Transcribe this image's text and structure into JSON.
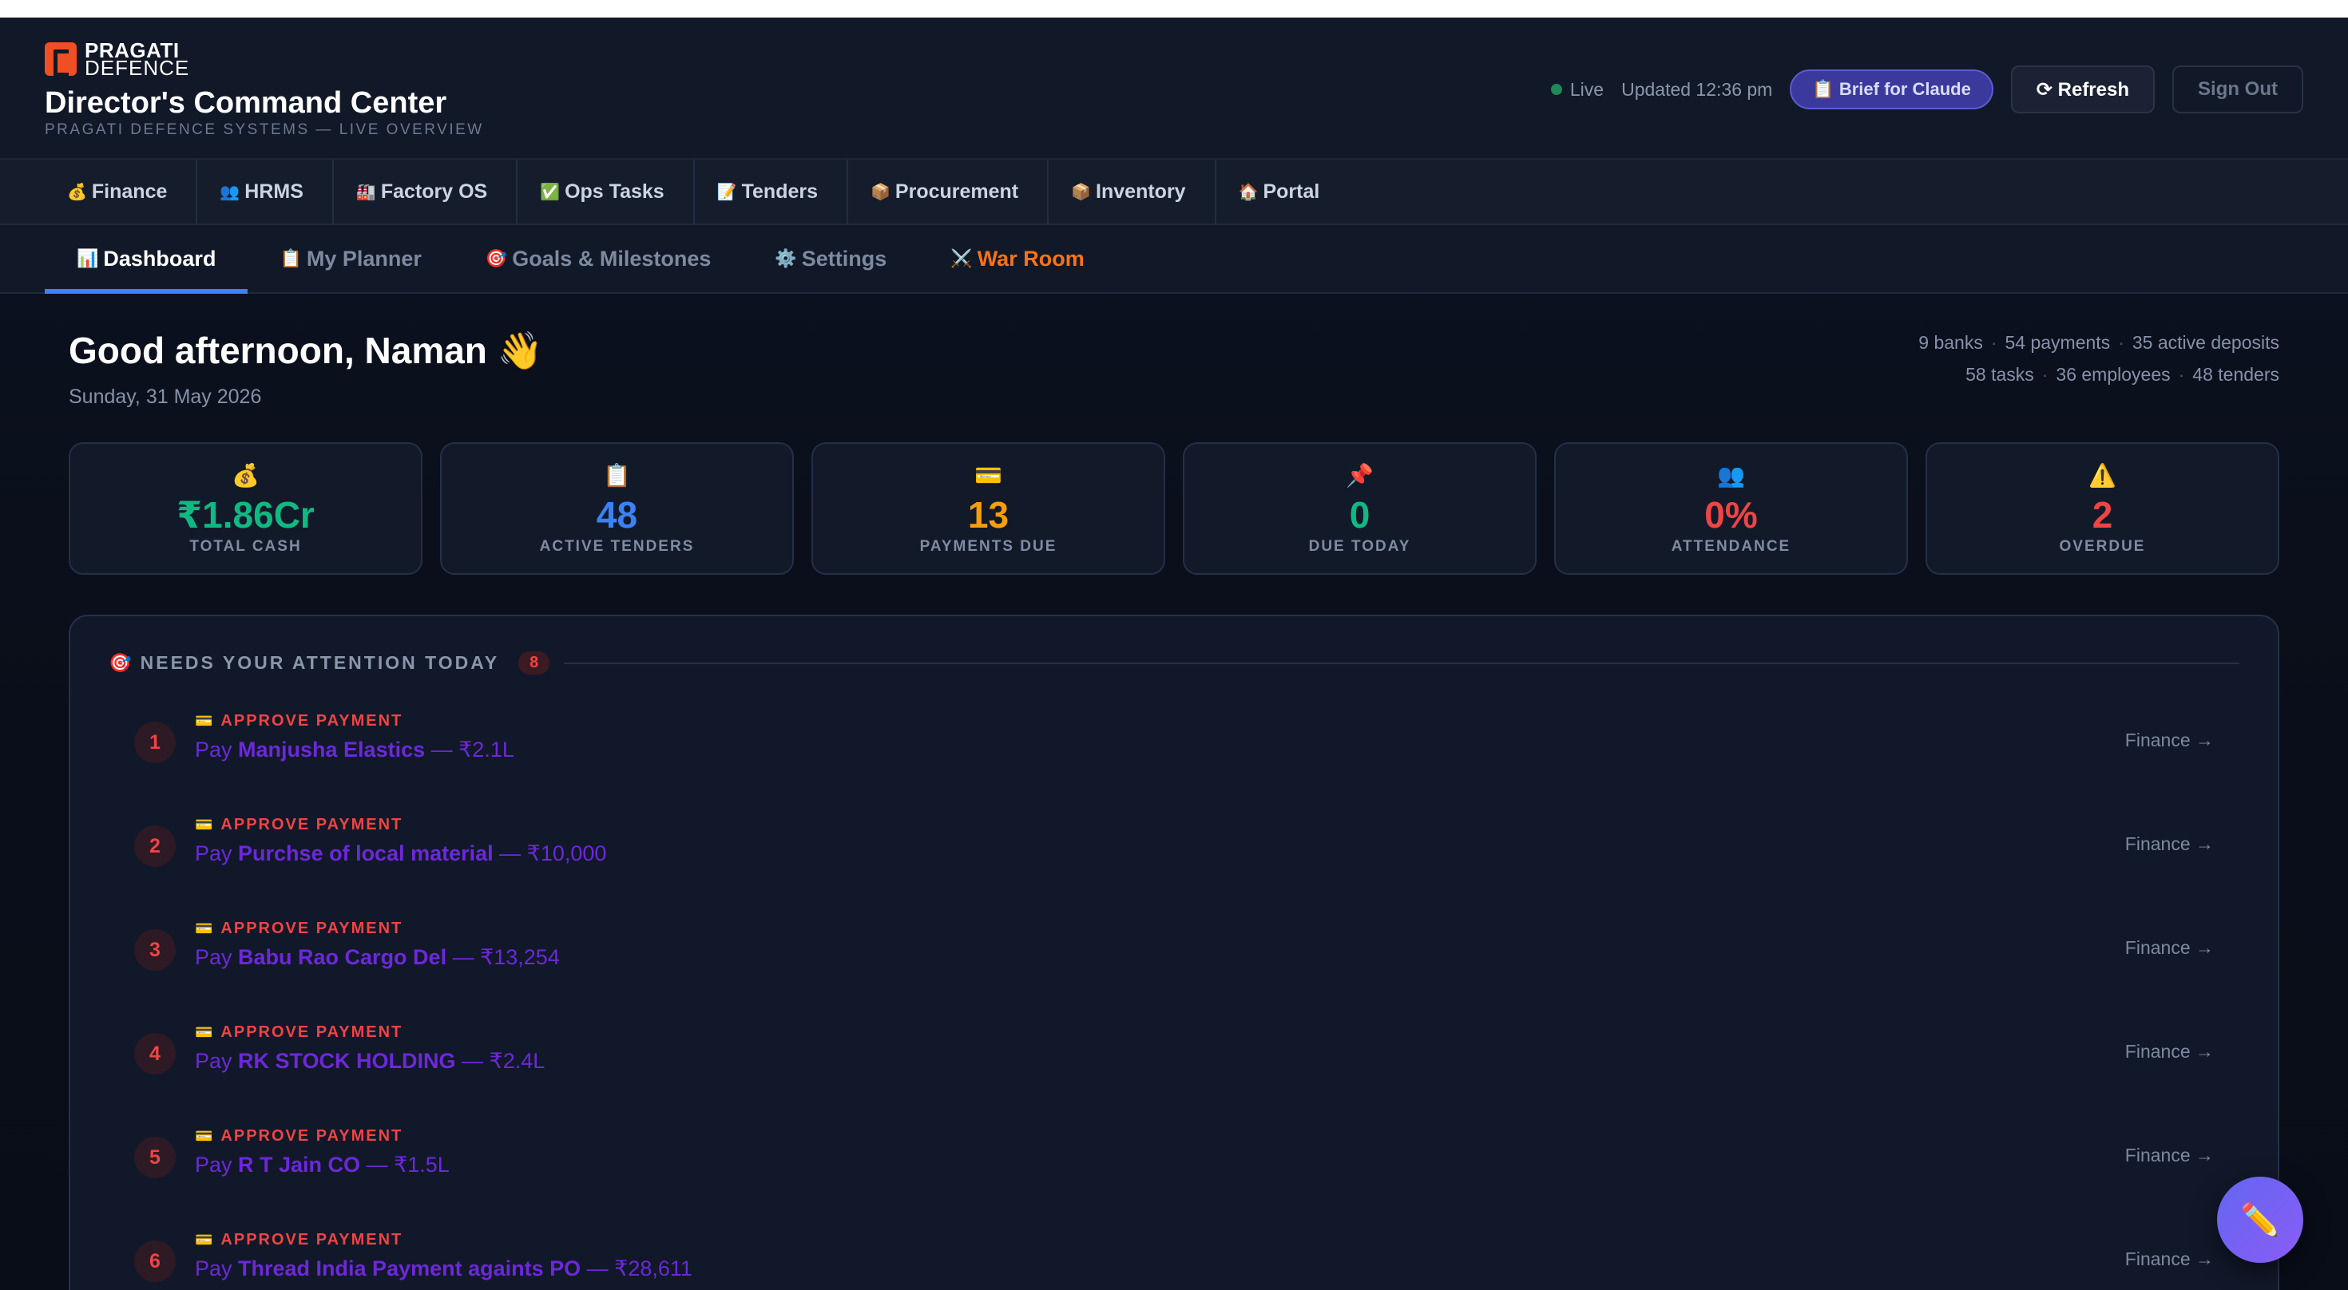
{
  "brand": {
    "line1": "PRAGATI",
    "line2": "DEFENCE"
  },
  "header": {
    "title": "Director's Command Center",
    "subtitle": "PRAGATI DEFENCE SYSTEMS — LIVE OVERVIEW",
    "live_label": "Live",
    "updated_label": "Updated 12:36 pm",
    "brief_label": "📋 Brief for Claude",
    "refresh_label": "⟳ Refresh",
    "signout_label": "Sign Out",
    "live_color": "#1f8a55"
  },
  "modules": [
    {
      "icon": "💰",
      "label": "Finance"
    },
    {
      "icon": "👥",
      "label": "HRMS"
    },
    {
      "icon": "🏭",
      "label": "Factory OS"
    },
    {
      "icon": "✅",
      "label": "Ops Tasks"
    },
    {
      "icon": "📝",
      "label": "Tenders"
    },
    {
      "icon": "📦",
      "label": "Procurement"
    },
    {
      "icon": "📦",
      "label": "Inventory"
    },
    {
      "icon": "🏠",
      "label": "Portal"
    }
  ],
  "tabs": [
    {
      "icon": "📊",
      "label": "Dashboard",
      "active": true
    },
    {
      "icon": "📋",
      "label": "My Planner"
    },
    {
      "icon": "🎯",
      "label": "Goals & Milestones"
    },
    {
      "icon": "⚙️",
      "label": "Settings"
    },
    {
      "icon": "⚔️",
      "label": "War Room"
    }
  ],
  "greeting": {
    "title": "Good afternoon, Naman 👋",
    "date": "Sunday, 31 May 2026"
  },
  "stats": {
    "line1": [
      "9 banks",
      "54 payments",
      "35 active deposits"
    ],
    "line2": [
      "58 tasks",
      "36 employees",
      "48 tenders"
    ],
    "separator": "·"
  },
  "kpis": [
    {
      "icon": "💰",
      "value": "₹1.86Cr",
      "label": "TOTAL CASH",
      "color": "#10b981"
    },
    {
      "icon": "📋",
      "value": "48",
      "label": "ACTIVE TENDERS",
      "color": "#3b82f6"
    },
    {
      "icon": "💳",
      "value": "13",
      "label": "PAYMENTS DUE",
      "color": "#f59e0b"
    },
    {
      "icon": "📌",
      "value": "0",
      "label": "DUE TODAY",
      "color": "#10b981"
    },
    {
      "icon": "👥",
      "value": "0%",
      "label": "ATTENDANCE",
      "color": "#ef4444"
    },
    {
      "icon": "⚠️",
      "value": "2",
      "label": "OVERDUE",
      "color": "#ef4444"
    }
  ],
  "attention": {
    "icon": "🎯",
    "title": "NEEDS YOUR ATTENTION TODAY",
    "count": "8",
    "items": [
      {
        "num": "1",
        "kind_icon": "💳",
        "kind": "APPROVE PAYMENT",
        "prefix": "Pay ",
        "name": "Manjusha Elastics",
        "amount": " — ₹2.1L",
        "link": "Finance →"
      },
      {
        "num": "2",
        "kind_icon": "💳",
        "kind": "APPROVE PAYMENT",
        "prefix": "Pay ",
        "name": "Purchse of local material",
        "amount": " — ₹10,000",
        "link": "Finance →"
      },
      {
        "num": "3",
        "kind_icon": "💳",
        "kind": "APPROVE PAYMENT",
        "prefix": "Pay ",
        "name": "Babu Rao Cargo Del",
        "amount": " — ₹13,254",
        "link": "Finance →"
      },
      {
        "num": "4",
        "kind_icon": "💳",
        "kind": "APPROVE PAYMENT",
        "prefix": "Pay ",
        "name": "RK STOCK HOLDING",
        "amount": " — ₹2.4L",
        "link": "Finance →"
      },
      {
        "num": "5",
        "kind_icon": "💳",
        "kind": "APPROVE PAYMENT",
        "prefix": "Pay ",
        "name": "R T Jain CO",
        "amount": " — ₹1.5L",
        "link": "Finance →"
      },
      {
        "num": "6",
        "kind_icon": "💳",
        "kind": "APPROVE PAYMENT",
        "prefix": "Pay ",
        "name": "Thread India Payment againts PO",
        "amount": " — ₹28,611",
        "link": "Finance →"
      }
    ]
  },
  "fab": {
    "icon": "✏️"
  }
}
